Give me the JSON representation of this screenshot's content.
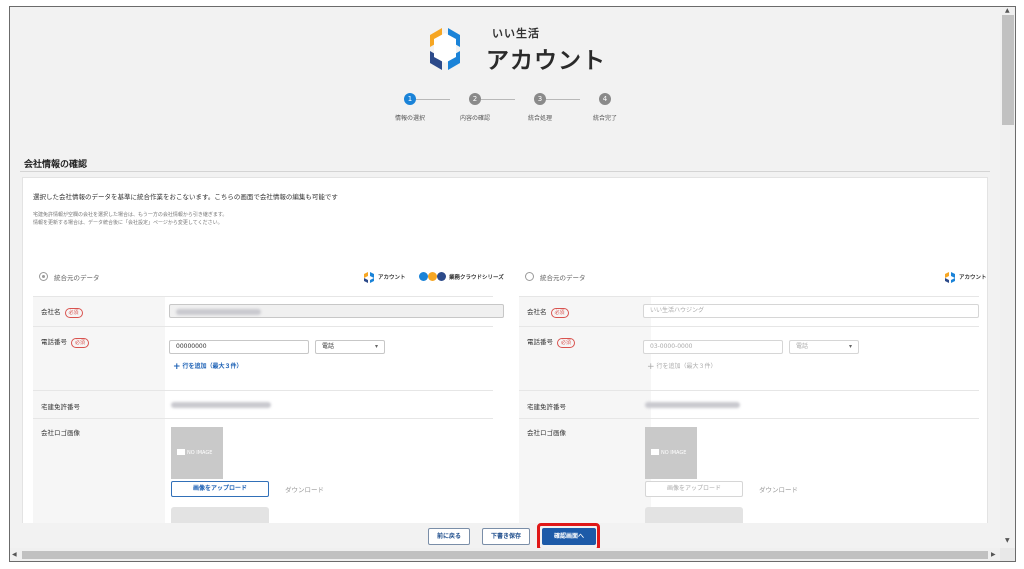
{
  "brand": {
    "subtitle": "いい生活",
    "title": "アカウント"
  },
  "stepper": {
    "steps": [
      {
        "num": "1",
        "label": "情報の選択",
        "active": true
      },
      {
        "num": "2",
        "label": "内容の確認",
        "active": false
      },
      {
        "num": "3",
        "label": "統合処理",
        "active": false
      },
      {
        "num": "4",
        "label": "統合完了",
        "active": false
      }
    ]
  },
  "section": {
    "title": "会社情報の確認",
    "intro": "選択した会社情報のデータを基準に統合作業をおこないます。こちらの画面で会社情報の編集も可能です",
    "note1": "宅建免許情報が空欄の会社を選択した場合は、もう一方の会社情報から引き継ぎます。",
    "note2": "情報を更新する場合は、データ統合後に「会社設定」ページから変更してください。"
  },
  "left": {
    "label": "統合元のデータ",
    "brand_small": "アカウント",
    "brand_series": "業務クラウドシリーズ",
    "company_name_label": "会社名",
    "required": "必須",
    "phone_label": "電話番号",
    "phone_value": "00000000",
    "phone_type": "電話",
    "add_row": "行を追加（最大３件）",
    "license_label": "宅建免許番号",
    "logo_label": "会社ロゴ画像",
    "no_image": "NO IMAGE",
    "upload": "画像をアップロード",
    "download": "ダウンロード"
  },
  "right": {
    "label": "統合元のデータ",
    "brand_small": "アカウント",
    "company_name_label": "会社名",
    "company_name_value": "いい生活ハウジング",
    "required": "必須",
    "phone_label": "電話番号",
    "phone_value": "03-0000-0000",
    "phone_type": "電話",
    "add_row": "行を追加（最大３件）",
    "license_label": "宅建免許番号",
    "logo_label": "会社ロゴ画像",
    "no_image": "NO IMAGE",
    "upload": "画像をアップロード",
    "download": "ダウンロード"
  },
  "footer": {
    "back": "前に戻る",
    "draft": "下書き保存",
    "confirm": "確認画面へ"
  },
  "colors": {
    "accent": "#1a83d8",
    "primary_button": "#1d5aa8",
    "required_badge": "#d9534f",
    "highlight": "#e01818"
  }
}
